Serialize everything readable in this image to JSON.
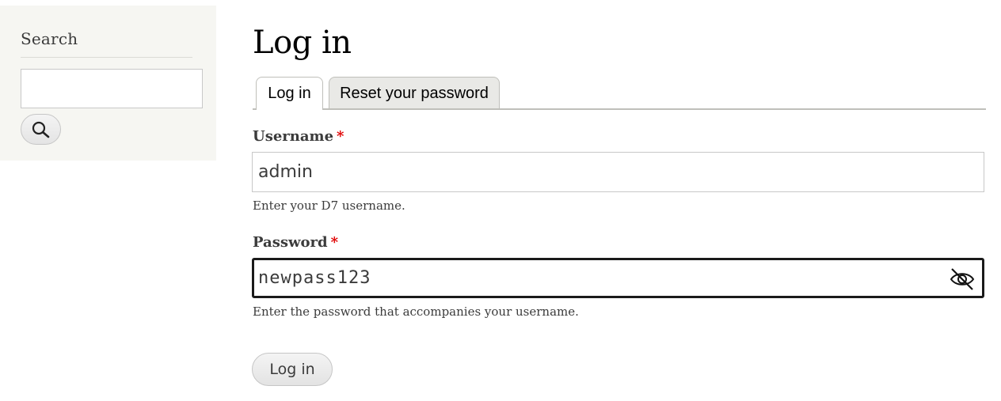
{
  "sidebar": {
    "search_title": "Search",
    "search_input_value": "",
    "search_button_icon": "search-icon"
  },
  "main": {
    "page_title": "Log in",
    "tabs": [
      {
        "label": "Log in",
        "active": true
      },
      {
        "label": "Reset your password",
        "active": false
      }
    ],
    "username": {
      "label": "Username",
      "required_marker": "*",
      "value": "admin",
      "description": "Enter your D7 username."
    },
    "password": {
      "label": "Password",
      "required_marker": "*",
      "value": "newpass123",
      "description": "Enter the password that accompanies your username.",
      "toggle_icon": "eye-slash-icon"
    },
    "submit_label": "Log in"
  },
  "colors": {
    "required": "#e00000",
    "sidebar_bg": "#f6f6f2",
    "text": "#3b3b3b"
  }
}
